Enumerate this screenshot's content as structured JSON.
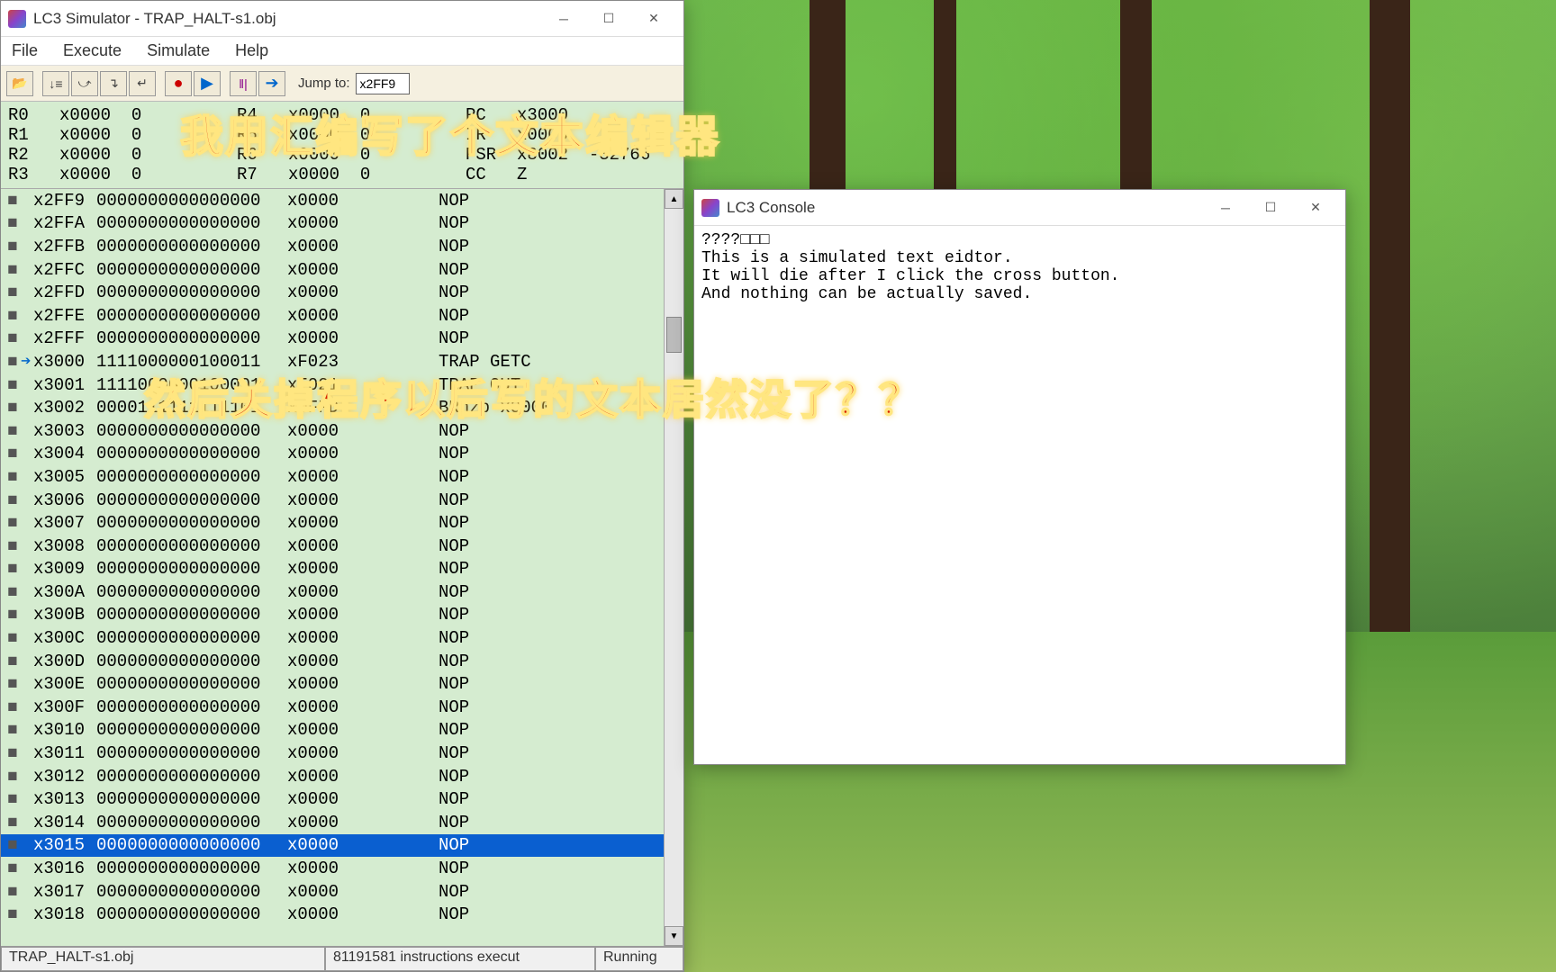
{
  "sim": {
    "title": "LC3 Simulator - TRAP_HALT-s1.obj",
    "menus": [
      "File",
      "Execute",
      "Simulate",
      "Help"
    ],
    "jump_label": "Jump to:",
    "jump_value": "x2FF9",
    "registers": {
      "col1": [
        "R0   x0000  0",
        "R1   x0000  0",
        "R2   x0000  0",
        "R3   x0000  0"
      ],
      "col2": [
        "R4   x0000  0",
        "R5   x0000  0",
        "R6   x0000  0",
        "R7   x0000  0"
      ],
      "col3": [
        "PC   x3000",
        "IR   x0000",
        "PSR  x8002  -32766",
        "CC   Z"
      ]
    },
    "memory": [
      {
        "bp": "■",
        "pc": "",
        "addr": "x2FF9",
        "bin": "0000000000000000",
        "hex": "x0000",
        "dis": "NOP"
      },
      {
        "bp": "■",
        "pc": "",
        "addr": "x2FFA",
        "bin": "0000000000000000",
        "hex": "x0000",
        "dis": "NOP"
      },
      {
        "bp": "■",
        "pc": "",
        "addr": "x2FFB",
        "bin": "0000000000000000",
        "hex": "x0000",
        "dis": "NOP"
      },
      {
        "bp": "■",
        "pc": "",
        "addr": "x2FFC",
        "bin": "0000000000000000",
        "hex": "x0000",
        "dis": "NOP"
      },
      {
        "bp": "■",
        "pc": "",
        "addr": "x2FFD",
        "bin": "0000000000000000",
        "hex": "x0000",
        "dis": "NOP"
      },
      {
        "bp": "■",
        "pc": "",
        "addr": "x2FFE",
        "bin": "0000000000000000",
        "hex": "x0000",
        "dis": "NOP"
      },
      {
        "bp": "■",
        "pc": "",
        "addr": "x2FFF",
        "bin": "0000000000000000",
        "hex": "x0000",
        "dis": "NOP"
      },
      {
        "bp": "■",
        "pc": "➔",
        "addr": "x3000",
        "bin": "1111000000100011",
        "hex": "xF023",
        "dis": "TRAP GETC"
      },
      {
        "bp": "■",
        "pc": "",
        "addr": "x3001",
        "bin": "1111000000100001",
        "hex": "xF021",
        "dis": "TRAP OUT"
      },
      {
        "bp": "■",
        "pc": "",
        "addr": "x3002",
        "bin": "0000111111111101",
        "hex": "x0FFD",
        "dis": "BRnzp x3000"
      },
      {
        "bp": "■",
        "pc": "",
        "addr": "x3003",
        "bin": "0000000000000000",
        "hex": "x0000",
        "dis": "NOP"
      },
      {
        "bp": "■",
        "pc": "",
        "addr": "x3004",
        "bin": "0000000000000000",
        "hex": "x0000",
        "dis": "NOP"
      },
      {
        "bp": "■",
        "pc": "",
        "addr": "x3005",
        "bin": "0000000000000000",
        "hex": "x0000",
        "dis": "NOP"
      },
      {
        "bp": "■",
        "pc": "",
        "addr": "x3006",
        "bin": "0000000000000000",
        "hex": "x0000",
        "dis": "NOP"
      },
      {
        "bp": "■",
        "pc": "",
        "addr": "x3007",
        "bin": "0000000000000000",
        "hex": "x0000",
        "dis": "NOP"
      },
      {
        "bp": "■",
        "pc": "",
        "addr": "x3008",
        "bin": "0000000000000000",
        "hex": "x0000",
        "dis": "NOP"
      },
      {
        "bp": "■",
        "pc": "",
        "addr": "x3009",
        "bin": "0000000000000000",
        "hex": "x0000",
        "dis": "NOP"
      },
      {
        "bp": "■",
        "pc": "",
        "addr": "x300A",
        "bin": "0000000000000000",
        "hex": "x0000",
        "dis": "NOP"
      },
      {
        "bp": "■",
        "pc": "",
        "addr": "x300B",
        "bin": "0000000000000000",
        "hex": "x0000",
        "dis": "NOP"
      },
      {
        "bp": "■",
        "pc": "",
        "addr": "x300C",
        "bin": "0000000000000000",
        "hex": "x0000",
        "dis": "NOP"
      },
      {
        "bp": "■",
        "pc": "",
        "addr": "x300D",
        "bin": "0000000000000000",
        "hex": "x0000",
        "dis": "NOP"
      },
      {
        "bp": "■",
        "pc": "",
        "addr": "x300E",
        "bin": "0000000000000000",
        "hex": "x0000",
        "dis": "NOP"
      },
      {
        "bp": "■",
        "pc": "",
        "addr": "x300F",
        "bin": "0000000000000000",
        "hex": "x0000",
        "dis": "NOP"
      },
      {
        "bp": "■",
        "pc": "",
        "addr": "x3010",
        "bin": "0000000000000000",
        "hex": "x0000",
        "dis": "NOP"
      },
      {
        "bp": "■",
        "pc": "",
        "addr": "x3011",
        "bin": "0000000000000000",
        "hex": "x0000",
        "dis": "NOP"
      },
      {
        "bp": "■",
        "pc": "",
        "addr": "x3012",
        "bin": "0000000000000000",
        "hex": "x0000",
        "dis": "NOP"
      },
      {
        "bp": "■",
        "pc": "",
        "addr": "x3013",
        "bin": "0000000000000000",
        "hex": "x0000",
        "dis": "NOP"
      },
      {
        "bp": "■",
        "pc": "",
        "addr": "x3014",
        "bin": "0000000000000000",
        "hex": "x0000",
        "dis": "NOP"
      },
      {
        "bp": "■",
        "pc": "",
        "addr": "x3015",
        "bin": "0000000000000000",
        "hex": "x0000",
        "dis": "NOP",
        "sel": true
      },
      {
        "bp": "■",
        "pc": "",
        "addr": "x3016",
        "bin": "0000000000000000",
        "hex": "x0000",
        "dis": "NOP"
      },
      {
        "bp": "■",
        "pc": "",
        "addr": "x3017",
        "bin": "0000000000000000",
        "hex": "x0000",
        "dis": "NOP"
      },
      {
        "bp": "■",
        "pc": "",
        "addr": "x3018",
        "bin": "0000000000000000",
        "hex": "x0000",
        "dis": "NOP"
      }
    ],
    "status": {
      "file": "TRAP_HALT-s1.obj",
      "count": "81191581 instructions execut",
      "state": "Running"
    }
  },
  "console": {
    "title": "LC3 Console",
    "text": "????□□□\nThis is a simulated text eidtor.\nIt will die after I click the cross button.\nAnd nothing can be actually saved."
  },
  "captions": {
    "line1": "我用汇编写了个文本编辑器",
    "line2": "然后关掉程序以后写的文本居然没了？？"
  },
  "toolbar_icons": [
    "📂",
    "↓≡",
    "⤻",
    "↴",
    "↵",
    "●",
    "▶",
    "‖|",
    "➔"
  ]
}
